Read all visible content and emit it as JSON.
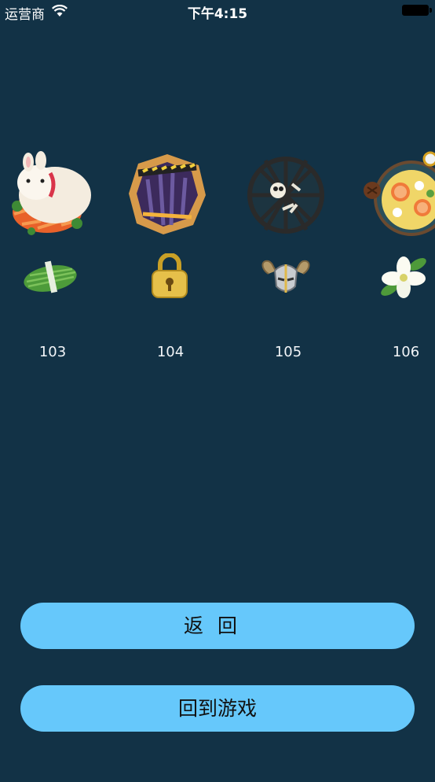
{
  "status_bar": {
    "carrier": "运营商",
    "time": "下午4:15"
  },
  "levels": [
    {
      "number": "103",
      "big_icon": "rabbit-on-carrots-icon",
      "small_icon": "green-bundle-icon"
    },
    {
      "number": "104",
      "big_icon": "cage-door-icon",
      "small_icon": "golden-padlock-icon"
    },
    {
      "number": "105",
      "big_icon": "caged-skull-icon",
      "small_icon": "horned-helmet-icon"
    },
    {
      "number": "106",
      "big_icon": "fruit-plate-icon",
      "small_icon": "white-flower-icon"
    }
  ],
  "buttons": {
    "back": "返回",
    "back_to_game": "回到游戏"
  },
  "colors": {
    "background": "#123246",
    "button": "#66c8fb"
  }
}
